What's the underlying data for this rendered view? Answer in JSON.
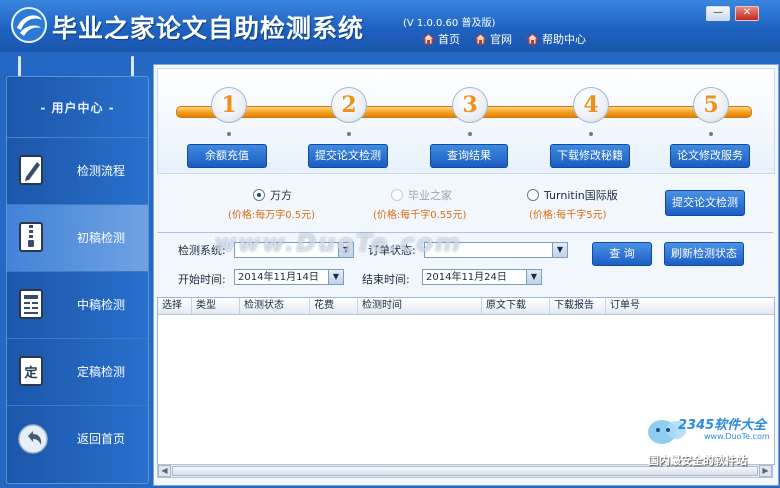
{
  "window": {
    "title": "毕业之家论文自助检测系统",
    "version": "(V 1.0.0.60 普及版)",
    "nav": [
      "首页",
      "官网",
      "帮助中心"
    ],
    "minimize_label": "—",
    "close_label": "✕"
  },
  "sidebar": {
    "heading": "- 用户中心 -",
    "items": [
      {
        "label": "检测流程",
        "icon": "pencil-document-icon",
        "active": false
      },
      {
        "label": "初稿检测",
        "icon": "zipper-document-icon",
        "active": true
      },
      {
        "label": "中稿检测",
        "icon": "newspaper-document-icon",
        "active": false
      },
      {
        "label": "定稿检测",
        "icon": "ding-document-icon",
        "active": false
      },
      {
        "label": "返回首页",
        "icon": "back-arrow-icon",
        "active": false
      }
    ],
    "ding_glyph": "定"
  },
  "steps": [
    {
      "num": "1",
      "label": "余额充值"
    },
    {
      "num": "2",
      "label": "提交论文检测"
    },
    {
      "num": "3",
      "label": "查询结果"
    },
    {
      "num": "4",
      "label": "下载修改秘籍"
    },
    {
      "num": "5",
      "label": "论文修改服务"
    }
  ],
  "options": [
    {
      "label": "万方",
      "price": "(价格:每万字0.5元)",
      "selected": true,
      "disabled": false
    },
    {
      "label": "毕业之家",
      "price": "(价格:每千字0.55元)",
      "selected": false,
      "disabled": true
    },
    {
      "label": "Turnitin国际版",
      "price": "(价格:每千字5元)",
      "selected": false,
      "disabled": false
    }
  ],
  "submit_button": "提交论文检测",
  "filters": {
    "system_label": "检测系统:",
    "system_value": "",
    "status_label": "订单状态:",
    "status_value": "",
    "start_label": "开始时间:",
    "start_value": "2014年11月14日",
    "end_label": "结束时间:",
    "end_value": "2014年11月24日",
    "query_button": "查 询",
    "refresh_button": "刷新检测状态"
  },
  "table": {
    "columns": [
      "选择",
      "类型",
      "检测状态",
      "花费",
      "检测时间",
      "原文下载",
      "下载报告",
      "订单号"
    ],
    "rows": []
  },
  "watermarks": {
    "site": "www.DuoTe.com",
    "brand": "2345软件大全",
    "brand_url": "www.DuoTe.com",
    "slogan": "国内最安全的软件站"
  }
}
